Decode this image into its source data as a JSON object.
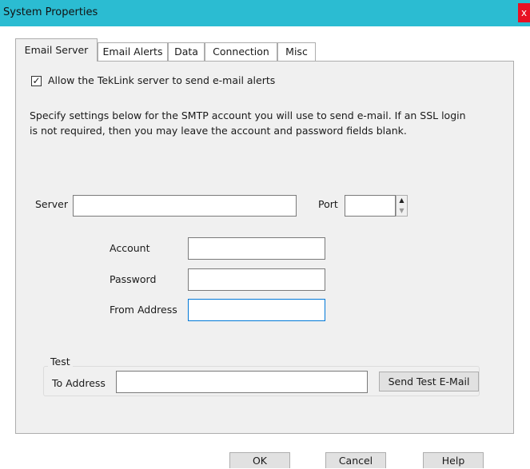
{
  "window": {
    "title": "System Properties",
    "close_glyph": "x"
  },
  "tabs": [
    {
      "label": "Email Server",
      "active": true
    },
    {
      "label": "Email Alerts",
      "active": false
    },
    {
      "label": "Data",
      "active": false
    },
    {
      "label": "Connection",
      "active": false
    },
    {
      "label": "Misc",
      "active": false
    }
  ],
  "email_server": {
    "allow_checkbox": {
      "label": "Allow the TekLink server to send e-mail alerts",
      "checked": true,
      "glyph": "✓"
    },
    "description": [
      "Specify settings below for the SMTP account you will use to send e-mail. If an SSL login",
      "is not required, then you may leave the account and password fields blank."
    ],
    "server": {
      "label": "Server",
      "value": ""
    },
    "port": {
      "label": "Port",
      "value": "",
      "up_glyph": "▲",
      "down_glyph": "▼"
    },
    "account": {
      "label": "Account",
      "value": ""
    },
    "password": {
      "label": "Password",
      "value": ""
    },
    "from_address": {
      "label": "From Address",
      "value": ""
    },
    "test": {
      "group_label": "Test",
      "to_address_label": "To Address",
      "to_address_value": "",
      "send_button": "Send Test E-Mail"
    }
  },
  "footer": {
    "ok": "OK",
    "cancel": "Cancel",
    "help": "Help"
  },
  "colors": {
    "titlebar": "#2bbcd2",
    "close": "#e81123",
    "pane": "#f0f0f0",
    "focus_border": "#0078d7"
  }
}
